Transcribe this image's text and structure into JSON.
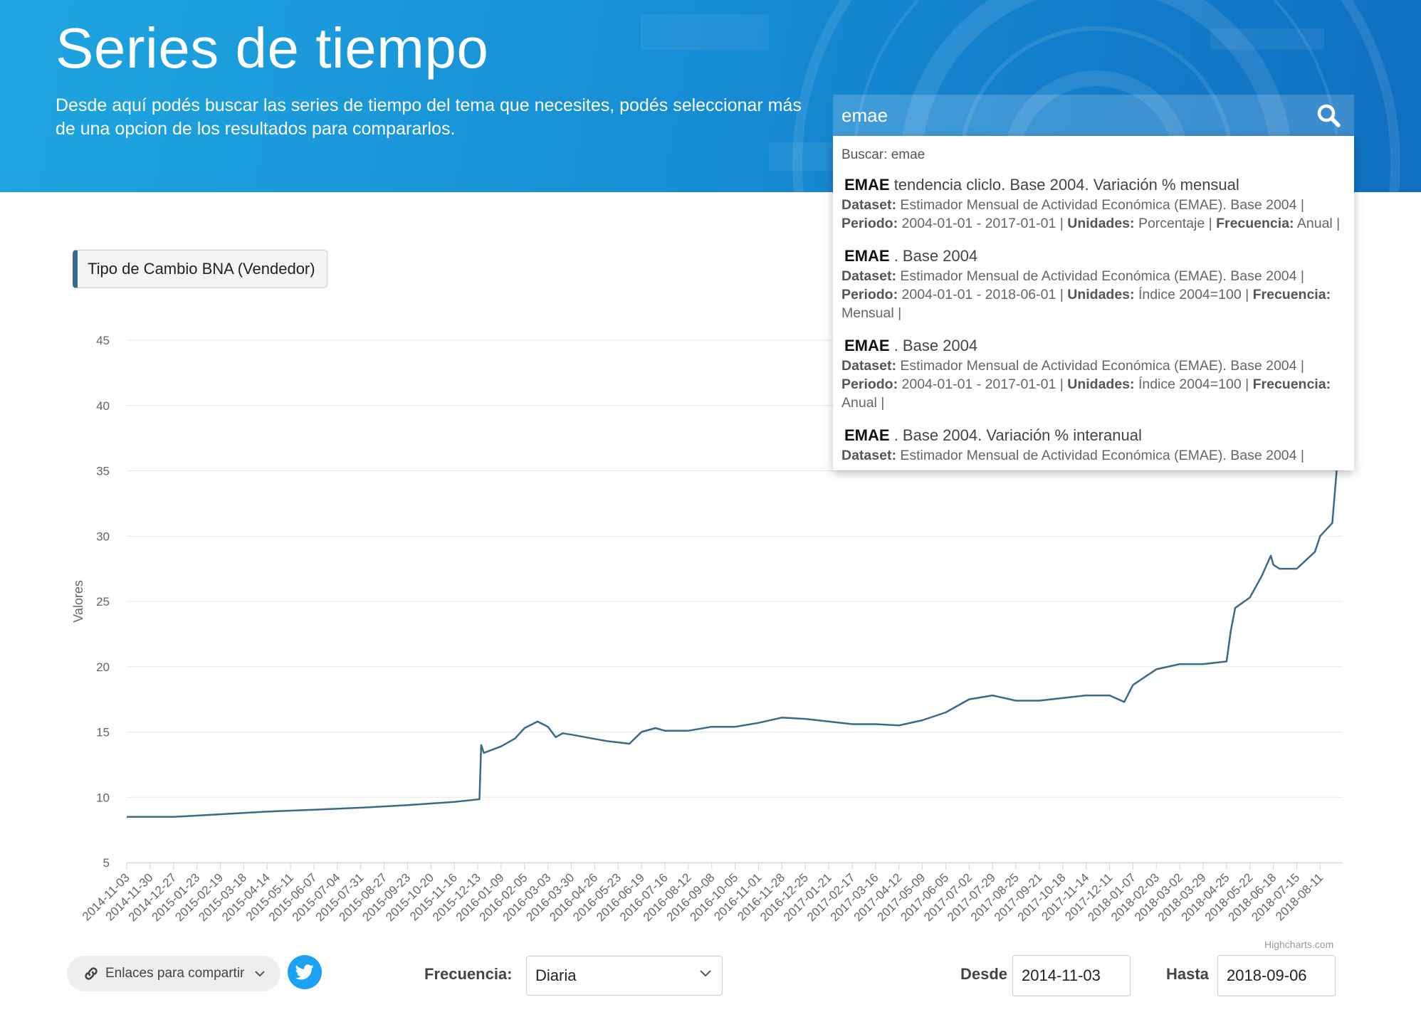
{
  "header": {
    "title": "Series de tiempo",
    "description": "Desde aquí podés buscar las series de tiempo del tema que necesites, podés seleccionar más de una opcion de los resultados para compararlos."
  },
  "search": {
    "value": "emae",
    "query_label": "Buscar: emae",
    "results": [
      {
        "keyword": "EMAE",
        "title": "tendencia cliclo. Base 2004. Variación % mensual",
        "dataset": "Estimador Mensual de Actividad Económica (EMAE). Base 2004",
        "periodo": "2004-01-01 - 2017-01-01",
        "unidades": "Porcentaje",
        "frecuencia": "Anual"
      },
      {
        "keyword": "EMAE",
        "title": ". Base 2004",
        "dataset": "Estimador Mensual de Actividad Económica (EMAE). Base 2004",
        "periodo": "2004-01-01 - 2018-06-01",
        "unidades": "Índice 2004=100",
        "frecuencia": "Mensual"
      },
      {
        "keyword": "EMAE",
        "title": ". Base 2004",
        "dataset": "Estimador Mensual de Actividad Económica (EMAE). Base 2004",
        "periodo": "2004-01-01 - 2017-01-01",
        "unidades": "Índice 2004=100",
        "frecuencia": "Anual"
      },
      {
        "keyword": "EMAE",
        "title": ". Base 2004. Variación % interanual",
        "dataset": "Estimador Mensual de Actividad Económica (EMAE). Base 2004",
        "periodo": "",
        "unidades": "",
        "frecuencia": ""
      }
    ],
    "labels": {
      "dataset": "Dataset:",
      "periodo": "Periodo:",
      "unidades": "Unidades:",
      "frecuencia": "Frecuencia:"
    }
  },
  "series_tag": {
    "label": "Tipo de Cambio BNA (Vendedor)"
  },
  "credits": "Highcharts.com",
  "controls": {
    "share_label": "Enlaces para compartir",
    "frecuencia_label": "Frecuencia:",
    "frecuencia_value": "Diaria",
    "desde_label": "Desde",
    "desde_value": "2014-11-03",
    "hasta_label": "Hasta",
    "hasta_value": "2018-09-06"
  },
  "colors": {
    "series": "#3a6a8a",
    "header_start": "#1ea5e0",
    "header_end": "#0f6fc1",
    "twitter": "#1da1f2"
  },
  "chart_data": {
    "type": "line",
    "ylabel": "Valores",
    "ylim": [
      5,
      45
    ],
    "yticks": [
      5,
      10,
      15,
      20,
      25,
      30,
      35,
      40,
      45
    ],
    "xlim": [
      "2014-11-03",
      "2018-09-06"
    ],
    "xticks": [
      "2014-11-03",
      "2014-11-30",
      "2014-12-27",
      "2015-01-23",
      "2015-02-19",
      "2015-03-18",
      "2015-04-14",
      "2015-05-11",
      "2015-06-07",
      "2015-07-04",
      "2015-07-31",
      "2015-08-27",
      "2015-09-23",
      "2015-10-20",
      "2015-11-16",
      "2015-12-13",
      "2016-01-09",
      "2016-02-05",
      "2016-03-03",
      "2016-03-30",
      "2016-04-26",
      "2016-05-23",
      "2016-06-19",
      "2016-07-16",
      "2016-08-12",
      "2016-09-08",
      "2016-10-05",
      "2016-11-01",
      "2016-11-28",
      "2016-12-25",
      "2017-01-21",
      "2017-02-17",
      "2017-03-16",
      "2017-04-12",
      "2017-05-09",
      "2017-06-05",
      "2017-07-02",
      "2017-07-29",
      "2017-08-25",
      "2017-09-21",
      "2017-10-18",
      "2017-11-14",
      "2017-12-11",
      "2018-01-07",
      "2018-02-03",
      "2018-03-02",
      "2018-03-29",
      "2018-04-25",
      "2018-05-22",
      "2018-06-18",
      "2018-07-15",
      "2018-08-11"
    ],
    "grid": true,
    "series": [
      {
        "name": "Tipo de Cambio BNA (Vendedor)",
        "x": [
          "2014-11-03",
          "2014-12-27",
          "2015-02-19",
          "2015-04-14",
          "2015-06-07",
          "2015-07-31",
          "2015-09-23",
          "2015-11-16",
          "2015-12-15",
          "2015-12-17",
          "2015-12-20",
          "2016-01-09",
          "2016-01-25",
          "2016-02-05",
          "2016-02-20",
          "2016-03-03",
          "2016-03-12",
          "2016-03-20",
          "2016-03-30",
          "2016-04-15",
          "2016-05-10",
          "2016-06-05",
          "2016-06-19",
          "2016-07-05",
          "2016-07-16",
          "2016-08-12",
          "2016-09-08",
          "2016-10-05",
          "2016-11-01",
          "2016-11-28",
          "2016-12-25",
          "2017-01-21",
          "2017-02-17",
          "2017-03-16",
          "2017-04-12",
          "2017-05-09",
          "2017-06-05",
          "2017-07-02",
          "2017-07-29",
          "2017-08-25",
          "2017-09-21",
          "2017-10-18",
          "2017-11-14",
          "2017-12-11",
          "2017-12-28",
          "2018-01-07",
          "2018-02-03",
          "2018-03-02",
          "2018-03-29",
          "2018-04-25",
          "2018-04-30",
          "2018-05-05",
          "2018-05-22",
          "2018-06-05",
          "2018-06-15",
          "2018-06-18",
          "2018-06-25",
          "2018-07-15",
          "2018-08-05",
          "2018-08-11",
          "2018-08-25",
          "2018-08-30",
          "2018-09-03",
          "2018-09-06"
        ],
        "y": [
          8.5,
          8.5,
          8.7,
          8.9,
          9.05,
          9.2,
          9.4,
          9.65,
          9.85,
          14.0,
          13.4,
          13.9,
          14.5,
          15.3,
          15.8,
          15.4,
          14.6,
          14.9,
          14.8,
          14.6,
          14.3,
          14.1,
          15.0,
          15.3,
          15.1,
          15.1,
          15.4,
          15.4,
          15.7,
          16.1,
          16.0,
          15.8,
          15.6,
          15.6,
          15.5,
          15.9,
          16.5,
          17.5,
          17.8,
          17.4,
          17.4,
          17.6,
          17.8,
          17.8,
          17.3,
          18.6,
          19.8,
          20.2,
          20.2,
          20.4,
          22.8,
          24.5,
          25.3,
          27.0,
          28.5,
          27.8,
          27.5,
          27.5,
          28.8,
          30.0,
          31.0,
          35.0,
          38.0,
          39.5
        ]
      }
    ]
  }
}
